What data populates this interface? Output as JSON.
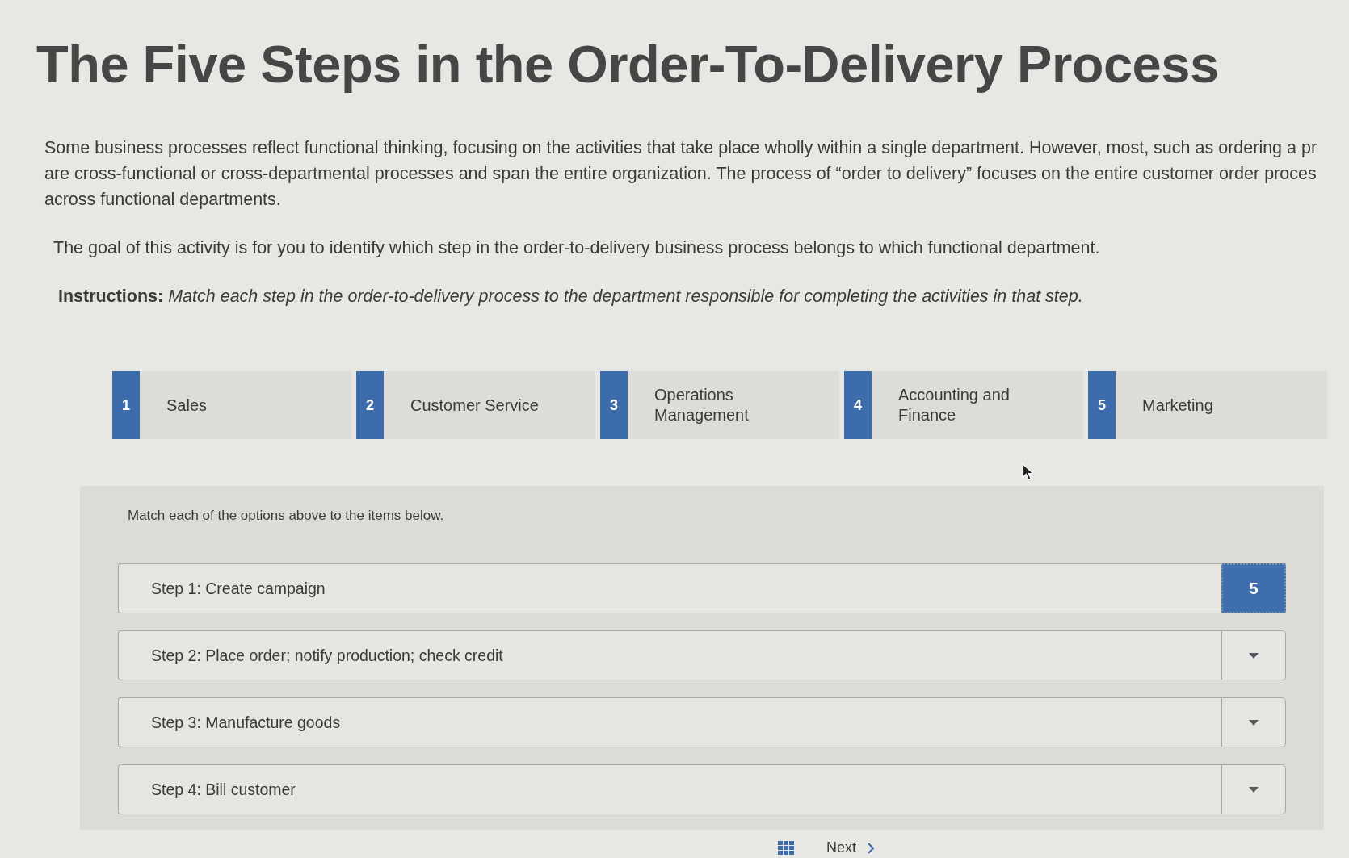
{
  "page": {
    "title": "The Five Steps in the Order-To-Delivery Process",
    "intro_lines": [
      "Some business processes reflect functional thinking, focusing on the activities that take place wholly within a single department. However, most, such as ordering a pr",
      "are cross-functional or cross-departmental processes and span the entire organization. The process of “order to delivery” focuses on the entire customer order proces",
      "across functional departments."
    ],
    "goal": "The goal of this activity is for you to identify which step in the order-to-delivery business process belongs to which functional department.",
    "instructions": "**Instructions:** *Match each step in the order-to-delivery process to the department responsible for completing the activities in that step.*"
  },
  "options": [
    {
      "number": "1",
      "label": "Sales"
    },
    {
      "number": "2",
      "label": "Customer Service"
    },
    {
      "number": "3",
      "label": "Operations Management"
    },
    {
      "number": "4",
      "label": "Accounting and Finance"
    },
    {
      "number": "5",
      "label": "Marketing"
    }
  ],
  "match_area": {
    "prompt": "Match each of the options above to the items below.",
    "items": [
      {
        "label": "Step 1: Create campaign",
        "kind": "filled",
        "answer": "5"
      },
      {
        "label": "Step 2: Place order; notify production; check credit",
        "kind": "empty"
      },
      {
        "label": "Step 3: Manufacture goods",
        "kind": "empty"
      },
      {
        "label": "Step 4: Bill customer",
        "kind": "empty"
      }
    ]
  },
  "footer": {
    "next": "Next"
  }
}
